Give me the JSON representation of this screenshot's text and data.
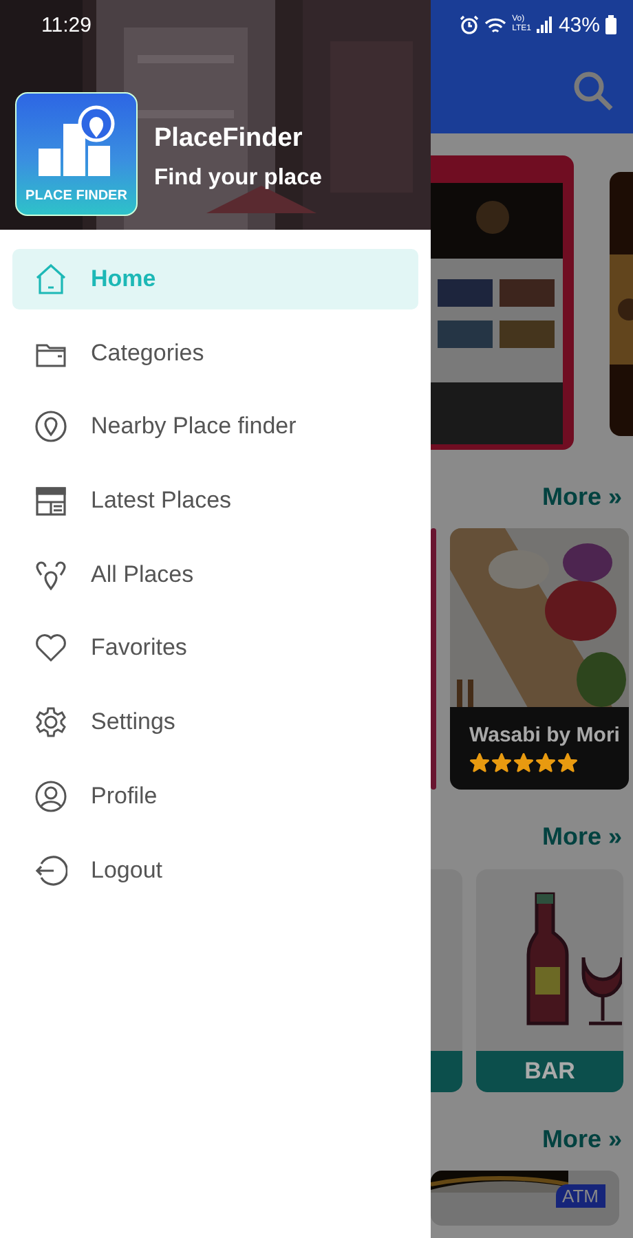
{
  "status_bar": {
    "time": "11:29",
    "network_top": "Vo)",
    "network_bottom": "LTE1",
    "battery": "43%"
  },
  "drawer": {
    "header": {
      "logo_text": "PLACE FINDER",
      "title": "PlaceFinder",
      "subtitle": "Find your place"
    },
    "menu": [
      {
        "label": "Home",
        "selected": true
      },
      {
        "label": "Categories",
        "selected": false
      },
      {
        "label": "Nearby Place finder",
        "selected": false
      },
      {
        "label": "Latest Places",
        "selected": false
      },
      {
        "label": "All Places",
        "selected": false
      },
      {
        "label": "Favorites",
        "selected": false
      },
      {
        "label": "Settings",
        "selected": false
      },
      {
        "label": "Profile",
        "selected": false
      },
      {
        "label": "Logout",
        "selected": false
      }
    ]
  },
  "background": {
    "more_links": [
      "More »",
      "More »",
      "More »"
    ],
    "featured_place": {
      "name": "Wasabi by Mori",
      "stars": 5
    },
    "category": {
      "label": "BAR"
    },
    "badge": "ATM"
  }
}
